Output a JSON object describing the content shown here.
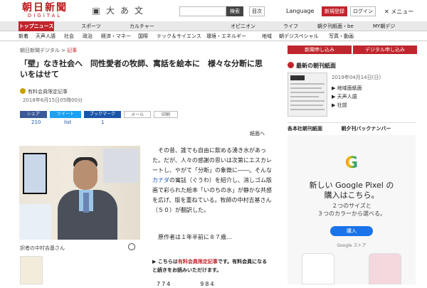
{
  "header": {
    "logo_line1": "朝日新聞",
    "logo_line2": "DIGITAL",
    "icons": [
      "gallery-icon",
      "font-size-icon",
      "text-a-icon",
      "speech-icon"
    ],
    "icon_glyphs": [
      "▣",
      "大",
      "あ",
      "文"
    ],
    "search_placeholder": "",
    "search_button": "検索",
    "toc_button": "目次",
    "language": "Language",
    "register_button": "新規登録",
    "login_button": "ログイン",
    "menu_label": "✕ メニュー"
  },
  "nav_primary": [
    "トップニュース",
    "スポーツ",
    "カルチャー",
    "ライフ",
    "オピニオン",
    "ライフ",
    "朝デジ",
    "MY朝デジ"
  ],
  "nav_primary_full": [
    {
      "label": "トップニュース"
    },
    {
      "label": "スポーツ"
    },
    {
      "label": "カルチャー"
    },
    {
      "label": "オピニオン"
    },
    {
      "label": "ライフ"
    },
    {
      "label": "朝夕刊紙面・be"
    },
    {
      "label": "MY朝デジ"
    }
  ],
  "nav_secondary": [
    "新着",
    "天声人語",
    "社会",
    "政治",
    "経済・マネー",
    "国際",
    "テック＆サイエンス",
    "環境・エネルギー",
    "地域",
    "朝デジスペシャル",
    "写真・動画"
  ],
  "breadcrumb": {
    "home": "朝日新聞デジタル",
    "sep": ">",
    "current": "記事"
  },
  "article": {
    "title": "「壁」なき社会へ　同性愛者の牧師、寓話を絵本に　様々な分断に思いをはせて",
    "premium": "有料会員限定記事",
    "date": "2018年6月15日05時00分",
    "share": [
      {
        "label": "シェア",
        "count": "210",
        "color": "#3b5998"
      },
      {
        "label": "ツイート",
        "count": "list",
        "color": "#1da1f2"
      },
      {
        "label": "ブックマーク",
        "count": "1",
        "color": "#1a55a8"
      },
      {
        "label": "メール",
        "count": "",
        "color": "#888"
      },
      {
        "label": "印刷",
        "count": "",
        "color": "#888"
      }
    ],
    "paper_view": "紙面へ",
    "photo_caption": "訳者の中村吉基さん",
    "body_before_link": "その昔、誰でも自由に飲める湧き水があった。だが、人々の感謝の思いは次第にエスカレートし、やがて「分断」の象徴に――。そんな",
    "body_link": "カナダ",
    "body_after_link": "の寓話（ぐうわ）を紹介し、消しゴム版画で彩られた絵本「いのちの水」が静かな共感を広げ、版を重ねている。牧師の中村吉基さん（５０）が翻訳した。",
    "body_para2": "原作者は１年半前に８７歳…",
    "notice_prefix": "こちらは",
    "notice_red": "有料会員限定記事",
    "notice_suffix": "です。有料会員になると続きをお読みいただけます。",
    "remaining": "774　　　　984"
  },
  "sidebar": {
    "btn_paper": "新聞申し込み",
    "btn_digital": "デジタル申し込み",
    "latest_title": "最新の朝刊紙面",
    "latest_date": "2019年04月14日(日)",
    "links": [
      "地域面紙面",
      "天声人語",
      "社説"
    ],
    "bottom_left": "各本社朝刊紙面",
    "bottom_right": "朝夕刊バックナンバー"
  },
  "ad": {
    "logo": "G",
    "title": "新しい Google Pixel の\n購入はこちら。",
    "subtitle": "２つのサイズと\n３つのカラーから選べる。",
    "buy": "購入",
    "small": "Google ストア"
  }
}
